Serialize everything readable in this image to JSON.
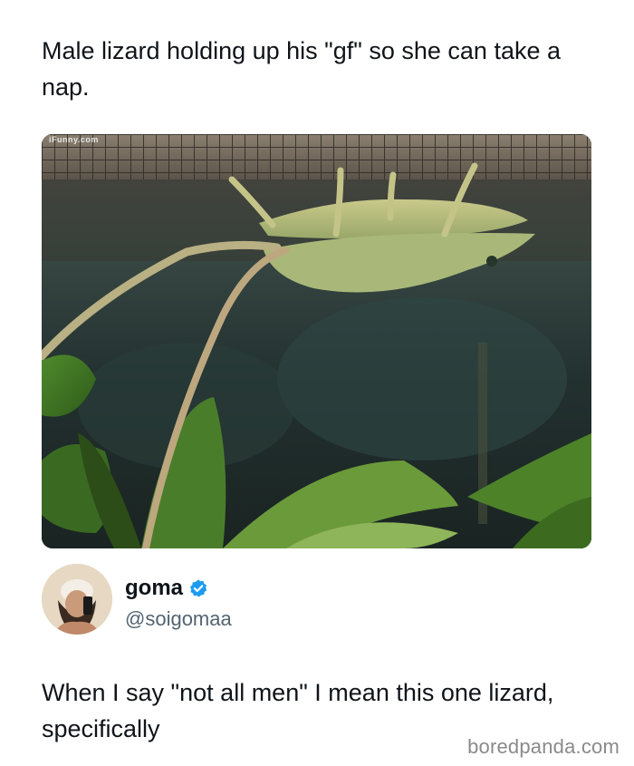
{
  "post": {
    "caption": "Male lizard holding up his \"gf\" so she can take a nap."
  },
  "photo": {
    "watermark": "iFunny.com"
  },
  "tweet": {
    "display_name": "goma",
    "handle": "@soigomaa",
    "text": "When I say \"not all men\" I mean this one lizard, specifically",
    "verified_color": "#1d9bf0"
  },
  "footer": {
    "source": "boredpanda.com"
  }
}
